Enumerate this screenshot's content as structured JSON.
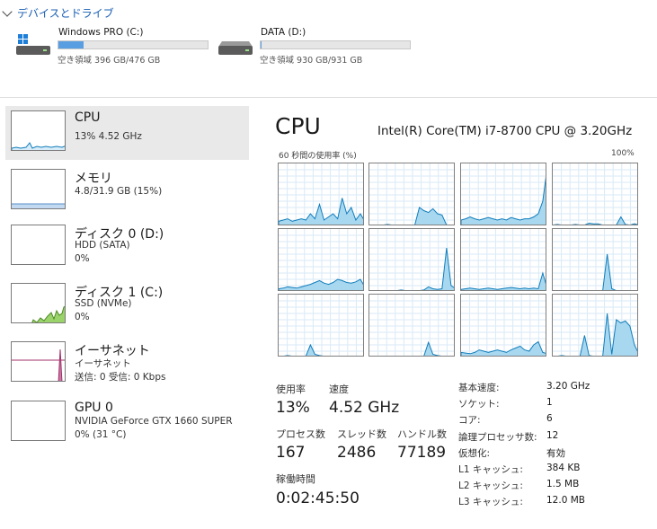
{
  "drives": {
    "header": "デバイスとドライブ",
    "items": [
      {
        "name": "Windows PRO (C:)",
        "free_text": "空き領域 396 GB/476 GB",
        "used_fraction": 0.168
      },
      {
        "name": "DATA (D:)",
        "free_text": "空き領域 930 GB/931 GB",
        "used_fraction": 0.001
      }
    ]
  },
  "sidebar": {
    "items": [
      {
        "title": "CPU",
        "line1": "13%  4.52 GHz",
        "line2": ""
      },
      {
        "title": "メモリ",
        "line1": "4.8/31.9 GB (15%)",
        "line2": ""
      },
      {
        "title": "ディスク 0 (D:)",
        "line1": "HDD (SATA)",
        "line2": "0%"
      },
      {
        "title": "ディスク 1 (C:)",
        "line1": "SSD (NVMe)",
        "line2": "0%"
      },
      {
        "title": "イーサネット",
        "line1": "イーサネット",
        "line2": "送信: 0  受信: 0 Kbps"
      },
      {
        "title": "GPU 0",
        "line1": "NVIDIA GeForce GTX 1660 SUPER",
        "line2": "0%  (31 °C)"
      }
    ]
  },
  "cpu": {
    "title": "CPU",
    "model": "Intel(R) Core(TM) i7-8700 CPU @ 3.20GHz",
    "graph_caption": "60 秒間の使用率 (%)",
    "graph_max": "100%",
    "stats": {
      "usage_label": "使用率",
      "usage_value": "13%",
      "speed_label": "速度",
      "speed_value": "4.52 GHz",
      "processes_label": "プロセス数",
      "processes_value": "167",
      "threads_label": "スレッド数",
      "threads_value": "2486",
      "handles_label": "ハンドル数",
      "handles_value": "77189",
      "uptime_label": "稼働時間",
      "uptime_value": "0:02:45:50"
    },
    "specs": [
      {
        "label": "基本速度:",
        "value": "3.20 GHz"
      },
      {
        "label": "ソケット:",
        "value": "1"
      },
      {
        "label": "コア:",
        "value": "6"
      },
      {
        "label": "論理プロセッサ数:",
        "value": "12"
      },
      {
        "label": "仮想化:",
        "value": "有効"
      },
      {
        "label": "L1 キャッシュ:",
        "value": "384 KB"
      },
      {
        "label": "L2 キャッシュ:",
        "value": "1.5 MB"
      },
      {
        "label": "L3 キャッシュ:",
        "value": "12.0 MB"
      }
    ]
  },
  "colors": {
    "cpu_line": "#117dbb",
    "cpu_fill": "#a8d8f0",
    "memory_fill": "#c3d9f1",
    "disk_fill": "#9bd36b",
    "ethernet_line": "#a0306a",
    "grid": "#d9eaf7"
  }
}
